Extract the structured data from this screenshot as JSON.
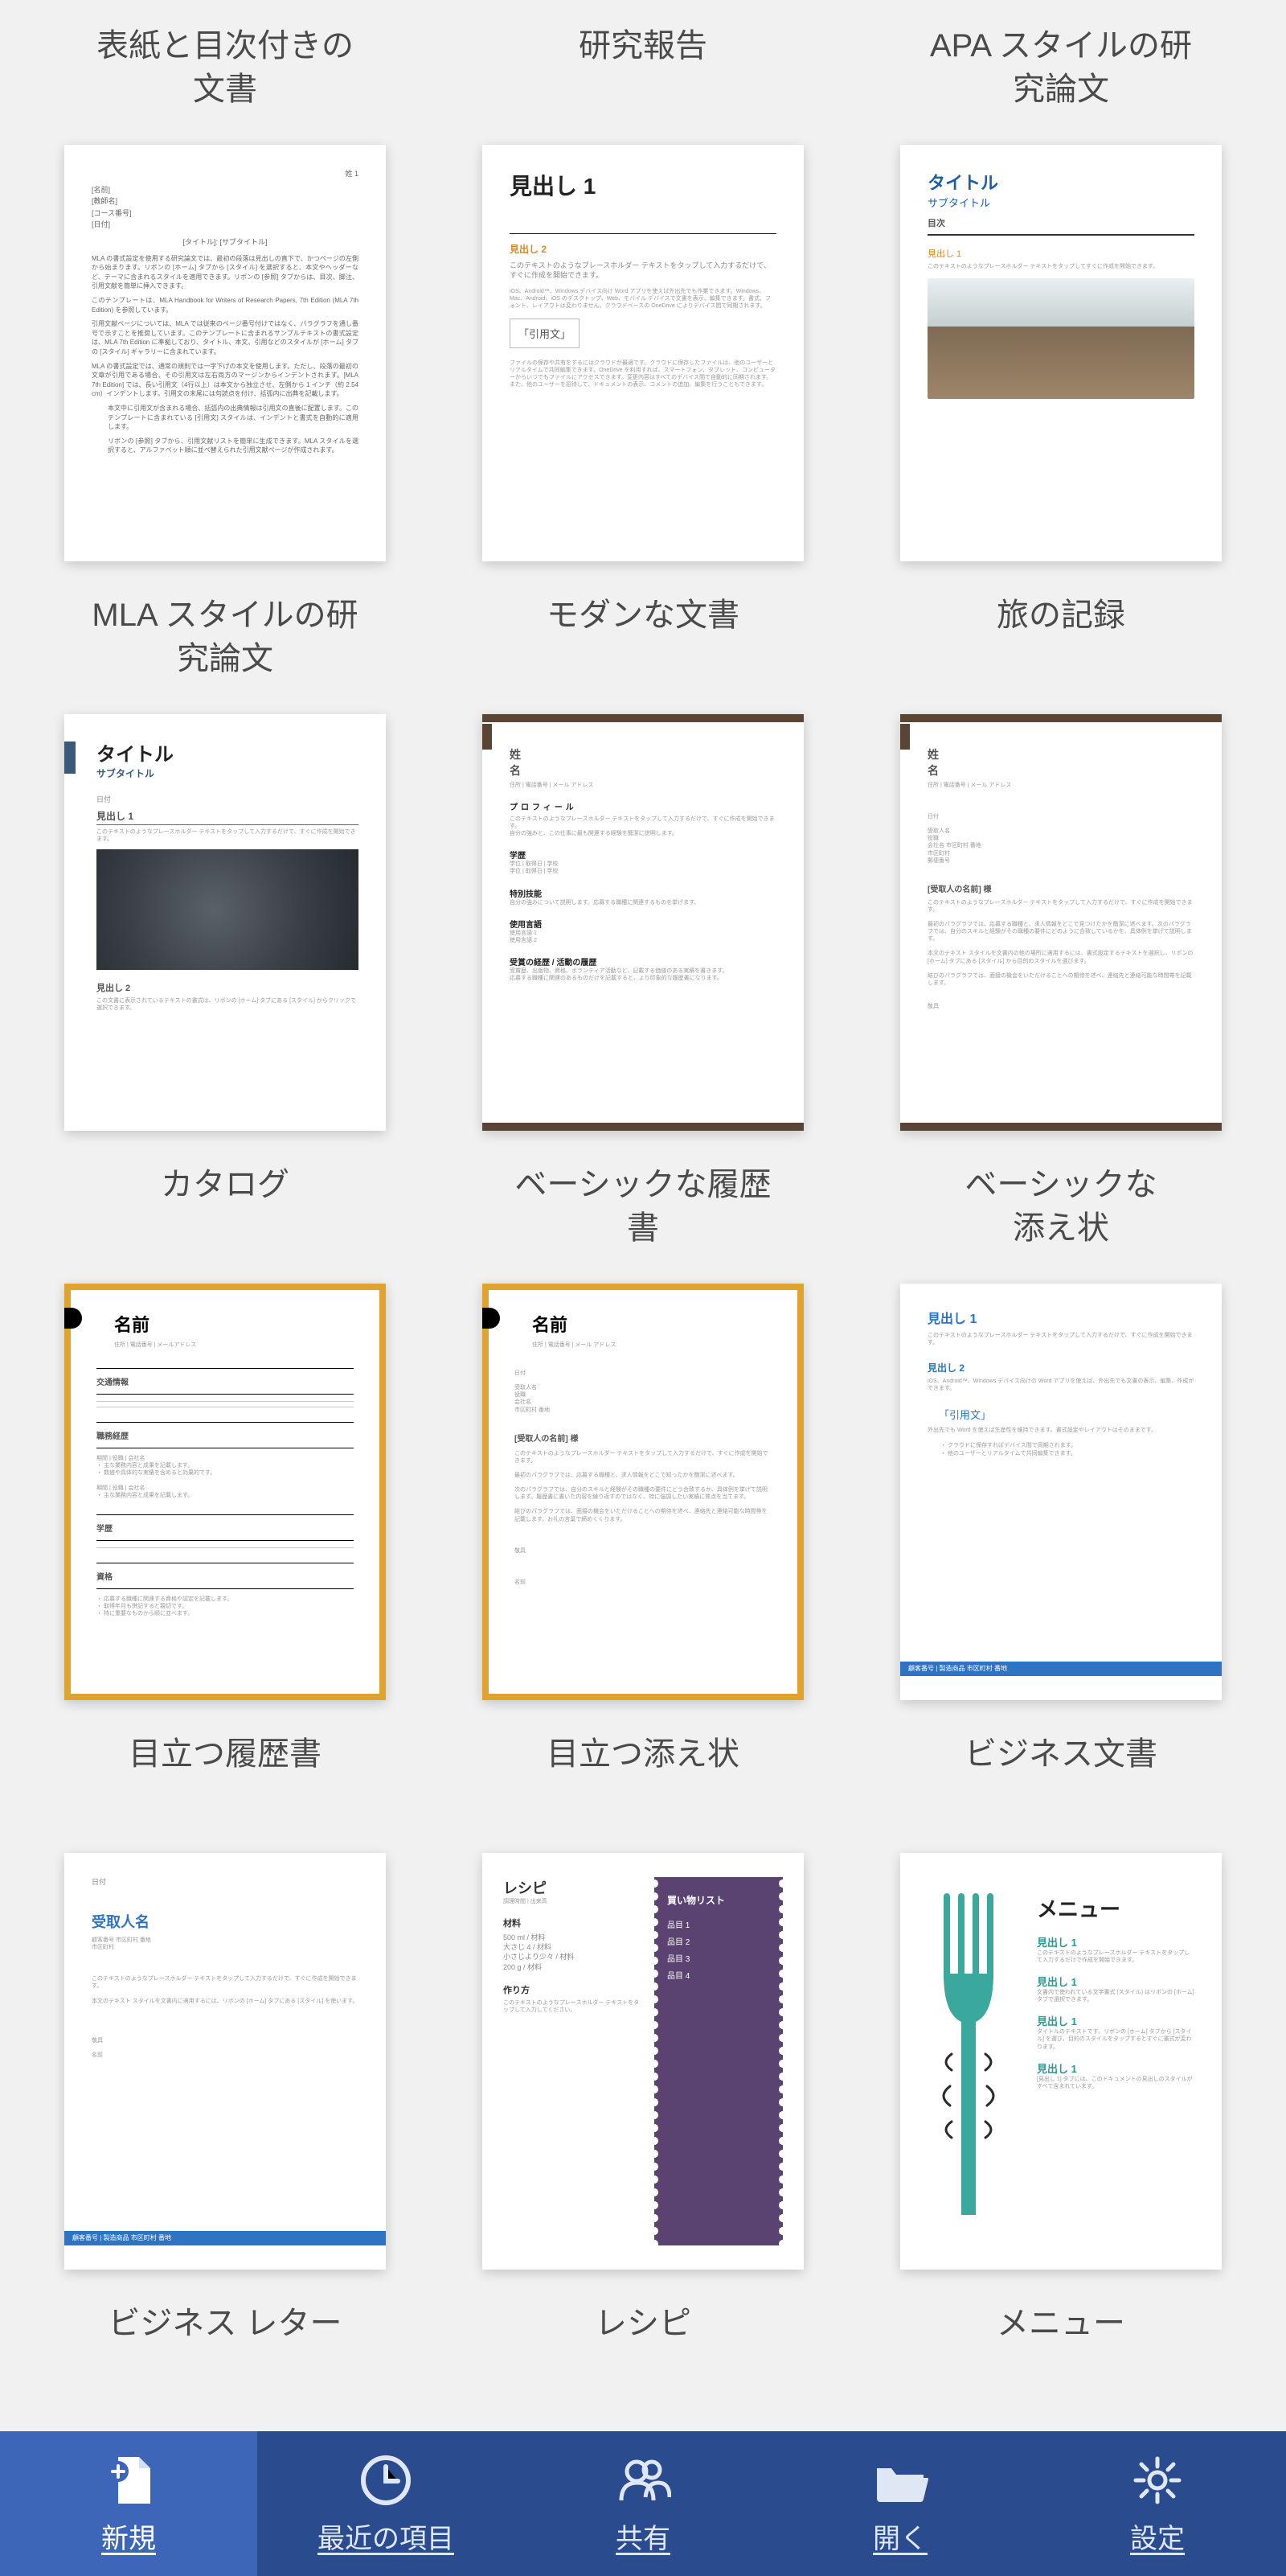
{
  "templates": [
    {
      "name": "表紙と目次付きの\n文書"
    },
    {
      "name": "研究報告"
    },
    {
      "name": "APA スタイルの研\n究論文"
    },
    {
      "name": "MLA スタイルの研\n究論文"
    },
    {
      "name": "モダンな文書"
    },
    {
      "name": "旅の記録"
    },
    {
      "name": "カタログ"
    },
    {
      "name": "ベーシックな履歴\n書"
    },
    {
      "name": "ベーシックな\n添え状"
    },
    {
      "name": "目立つ履歴書"
    },
    {
      "name": "目立つ添え状"
    },
    {
      "name": "ビジネス文書"
    },
    {
      "name": "ビジネス レター"
    },
    {
      "name": "レシピ"
    },
    {
      "name": "メニュー"
    }
  ],
  "thumbs": {
    "modern": {
      "heading": "見出し 1",
      "section": "見出し 2",
      "body": "このテキストのようなプレースホルダー テキストをタップして入力するだけで、すぐに作成を開始できます。",
      "quote": "「引用文」"
    },
    "travel": {
      "title": "タイトル",
      "subtitle": "サブタイトル",
      "toc": "目次",
      "h": "見出し 1",
      "body": "このテキストのようなプレースホルダー テキストをタップしてすぐに作成を開始できます。"
    },
    "catalog": {
      "title": "タイトル",
      "subtitle": "サブタイトル",
      "date": "日付",
      "h1": "見出し 1",
      "h2": "見出し 2"
    },
    "resume": {
      "name": "姓\n名",
      "prof": "プロフィール",
      "exp": "学歴",
      "skills": "特別技能",
      "lang": "使用言語",
      "awards": "受賞の経歴 / 活動の履歴"
    },
    "cover": {
      "name": "姓\n名",
      "to": "[受取人の名前] 様"
    },
    "bold_resume": {
      "name": "名前",
      "contact": "交通情報"
    },
    "bold_cover": {
      "name": "名前",
      "to": "[受取人の名前] 様"
    },
    "biz_doc": {
      "h1": "見出し 1",
      "h2": "見出し 2",
      "quote": "「引用文」",
      "footer": "顧客番号 | 製造商品 市区町村 番地"
    },
    "biz_letter": {
      "date": "日付",
      "to": "受取人名",
      "footer": "顧客番号 | 製造商品 市区町村 番地"
    },
    "recipe": {
      "title": "レシピ",
      "sub": "調理時間 | 出来高",
      "mat": "材料",
      "items": [
        "500 ml / 材料",
        "大さじ 4 / 材料",
        "小さじより少々 / 材料",
        "200 g / 材料"
      ],
      "how": "作り方",
      "panel_title": "買い物リスト",
      "panel_items": [
        "品目 1",
        "品目 2",
        "品目 3",
        "品目 4"
      ]
    },
    "menu": {
      "title": "メニュー",
      "h": "見出し 1"
    }
  },
  "tabs": {
    "new": "新規",
    "recent": "最近の項目",
    "shared": "共有",
    "open": "開く",
    "settings": "設定"
  }
}
